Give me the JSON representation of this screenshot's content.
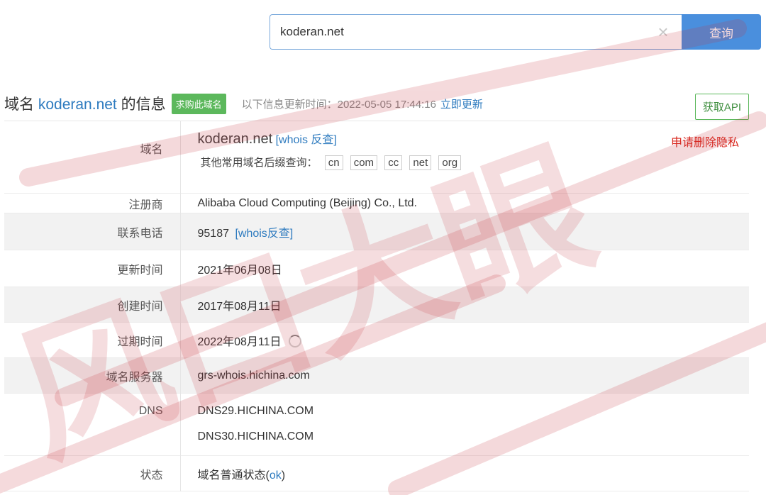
{
  "search": {
    "value": "koderan.net",
    "button_label": "查询",
    "clear_icon": "close-icon"
  },
  "header": {
    "title_prefix": "域名 ",
    "domain": "koderan.net",
    "title_suffix": " 的信息",
    "buy_badge": "求购此域名",
    "update_info": "以下信息更新时间：2022-05-05 17:44:16",
    "update_link": "立即更新",
    "api_button": "获取API"
  },
  "rows": {
    "domain": {
      "label": "域名",
      "value": "koderan.net",
      "whois_link": "[whois 反查]",
      "privacy_link": "申请删除隐私",
      "suffix_label": "其他常用域名后缀查询：",
      "suffixes": [
        "cn",
        "com",
        "cc",
        "net",
        "org"
      ]
    },
    "registrar": {
      "label": "注册商",
      "value": "Alibaba Cloud Computing (Beijing) Co., Ltd."
    },
    "phone": {
      "label": "联系电话",
      "value": "95187",
      "whois_link": "[whois反查]"
    },
    "updated": {
      "label": "更新时间",
      "value": "2021年06月08日"
    },
    "created": {
      "label": "创建时间",
      "value": "2017年08月11日"
    },
    "expires": {
      "label": "过期时间",
      "value": "2022年08月11日",
      "icon": "refresh-spinner-icon"
    },
    "whois_server": {
      "label": "域名服务器",
      "value": "grs-whois.hichina.com"
    },
    "dns": {
      "label": "DNS",
      "values": [
        "DNS29.HICHINA.COM",
        "DNS30.HICHINA.COM"
      ]
    },
    "status": {
      "label": "状态",
      "prefix": "域名普通状态(",
      "status": "ok",
      "suffix": ")"
    }
  },
  "colors": {
    "accent": "#4a8fdd",
    "link": "#2e7bbf",
    "badge": "#5cb85c",
    "privacy": "#d9261c",
    "watermark": "#c8323c"
  },
  "watermark": {
    "text": "风口大眼",
    "kind": "stamp"
  }
}
